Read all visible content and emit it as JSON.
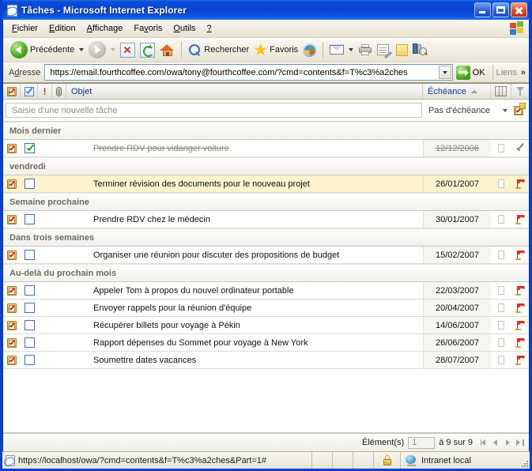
{
  "window": {
    "title": "Tâches - Microsoft Internet Explorer",
    "app_icon": "ie-page-icon",
    "minimize_label": "",
    "maximize_label": "",
    "close_label": ""
  },
  "menu": {
    "items": [
      {
        "label": "Fichier",
        "accel": "F"
      },
      {
        "label": "Edition",
        "accel": "E"
      },
      {
        "label": "Affichage",
        "accel": "A"
      },
      {
        "label": "Favoris",
        "accel": "v"
      },
      {
        "label": "Outils",
        "accel": "O"
      },
      {
        "label": "?",
        "accel": ""
      }
    ]
  },
  "toolbar": {
    "back_label": "Précédente",
    "forward_label": "",
    "stop_label": "",
    "refresh_label": "",
    "home_label": "",
    "search_label": "Rechercher",
    "favorites_label": "Favoris",
    "media_label": "",
    "mail_label": "",
    "print_label": "",
    "edit_label": "",
    "notes_label": "",
    "research_label": ""
  },
  "address": {
    "label": "Adresse",
    "accel": "d",
    "url": "https://email.fourthcoffee.com/owa/tony@fourthcoffee.com/?cmd=contents&f=T%c3%a2ches",
    "go_label": "OK",
    "links_label": "Liens",
    "chevron": "»"
  },
  "columns": {
    "icon": "task-icon",
    "complete": "complete-checkbox",
    "priority": "!",
    "attachment": "paperclip-icon",
    "subject": "Objet",
    "due": "Échéance",
    "column_chooser": "column-chooser-icon",
    "filter": "filter-funnel-icon"
  },
  "new_task": {
    "placeholder": "Saisie d'une nouvelle tâche",
    "due_label": "Pas d'échéance",
    "button_title": "new-task-button"
  },
  "groups": [
    {
      "label": "Mois dernier",
      "tasks": [
        {
          "subject": "Prendre RDV pour vidanger voiture",
          "due": "12/12/2006",
          "complete": true,
          "flag": "check",
          "highlight": false
        }
      ]
    },
    {
      "label": "vendredi",
      "tasks": [
        {
          "subject": "Terminer révision des documents pour le nouveau projet",
          "due": "26/01/2007",
          "complete": false,
          "flag": "red",
          "highlight": true
        }
      ]
    },
    {
      "label": "Semaine prochaine",
      "tasks": [
        {
          "subject": "Prendre RDV chez le médecin",
          "due": "30/01/2007",
          "complete": false,
          "flag": "red",
          "highlight": false
        }
      ]
    },
    {
      "label": "Dans trois semaines",
      "tasks": [
        {
          "subject": "Organiser une réunion pour discuter des propositions de budget",
          "due": "15/02/2007",
          "complete": false,
          "flag": "red",
          "highlight": false
        }
      ]
    },
    {
      "label": "Au-delà du prochain mois",
      "tasks": [
        {
          "subject": "Appeler Tom à propos du nouvel ordinateur portable",
          "due": "22/03/2007",
          "complete": false,
          "flag": "red",
          "highlight": false
        },
        {
          "subject": "Envoyer rappels pour la réunion d'équipe",
          "due": "20/04/2007",
          "complete": false,
          "flag": "red",
          "highlight": false
        },
        {
          "subject": "Récupérer billets pour voyage à Pékin",
          "due": "14/06/2007",
          "complete": false,
          "flag": "red",
          "highlight": false
        },
        {
          "subject": "Rapport dépenses du Sommet pour voyage à New York",
          "due": "26/06/2007",
          "complete": false,
          "flag": "red",
          "highlight": false
        },
        {
          "subject": "Soumettre dates vacances",
          "due": "28/07/2007",
          "complete": false,
          "flag": "red",
          "highlight": false
        }
      ]
    }
  ],
  "pager": {
    "items_label": "Élément(s)",
    "from_value": "1",
    "range_label": "à 9 sur 9"
  },
  "statusbar": {
    "url": "https://localhost/owa/?cmd=contents&f=T%c3%a2ches&Part=1#",
    "zone": "Intranet local"
  },
  "colors": {
    "title_blue": "#0a43d0",
    "highlight_row": "#fdf3cd",
    "link_blue": "#0b3a8c",
    "flag_red": "#e03020"
  }
}
